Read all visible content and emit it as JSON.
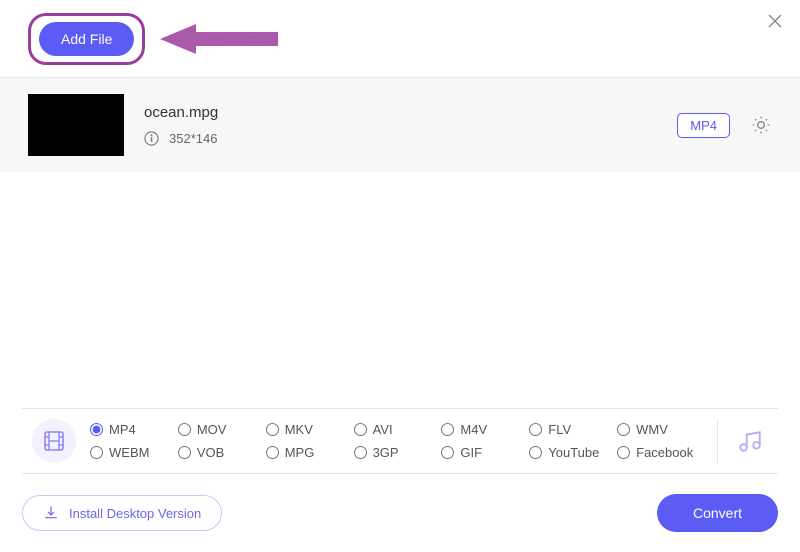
{
  "toolbar": {
    "add_file_label": "Add File"
  },
  "file": {
    "name": "ocean.mpg",
    "resolution": "352*146",
    "output_format": "MP4"
  },
  "formats": {
    "row1": [
      "MP4",
      "MOV",
      "MKV",
      "AVI",
      "M4V",
      "FLV",
      "WMV"
    ],
    "row2": [
      "WEBM",
      "VOB",
      "MPG",
      "3GP",
      "GIF",
      "YouTube",
      "Facebook"
    ],
    "selected": "MP4"
  },
  "footer": {
    "install_label": "Install Desktop Version",
    "convert_label": "Convert"
  }
}
